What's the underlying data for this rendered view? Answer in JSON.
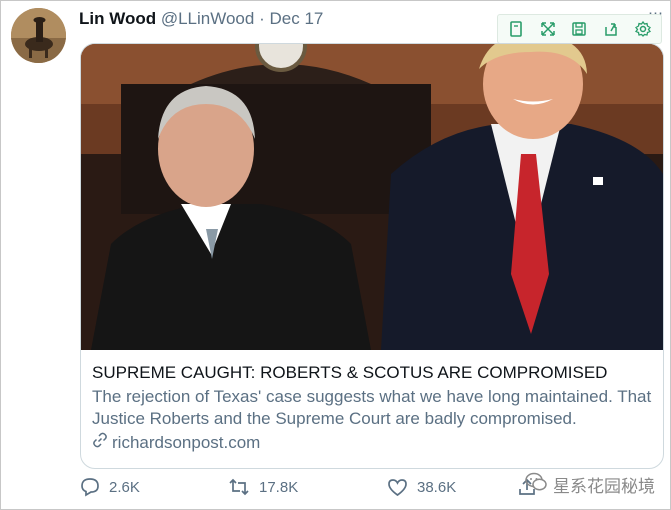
{
  "tweet": {
    "author": "Lin Wood",
    "handle": "@LLinWood",
    "separator": "·",
    "date": "Dec 17",
    "more": "..."
  },
  "card": {
    "title": "SUPREME CAUGHT: ROBERTS & SCOTUS ARE COMPROMISED",
    "description": "The rejection of Texas' case suggests what we have long maintained. That Justice Roberts and the Supreme Court are badly compromised.",
    "domain": "richardsonpost.com"
  },
  "actions": {
    "reply_count": "2.6K",
    "retweet_count": "17.8K",
    "like_count": "38.6K"
  },
  "toolbar": {
    "icons": [
      "bookmark-icon",
      "expand-icon",
      "save-icon",
      "share-icon",
      "settings-icon"
    ],
    "accent": "#2a9d6a"
  },
  "watermark": {
    "text": "星系花园秘境"
  },
  "colors": {
    "primary_text": "#0f1419",
    "secondary_text": "#5b7083",
    "card_border": "#cfd9de"
  }
}
